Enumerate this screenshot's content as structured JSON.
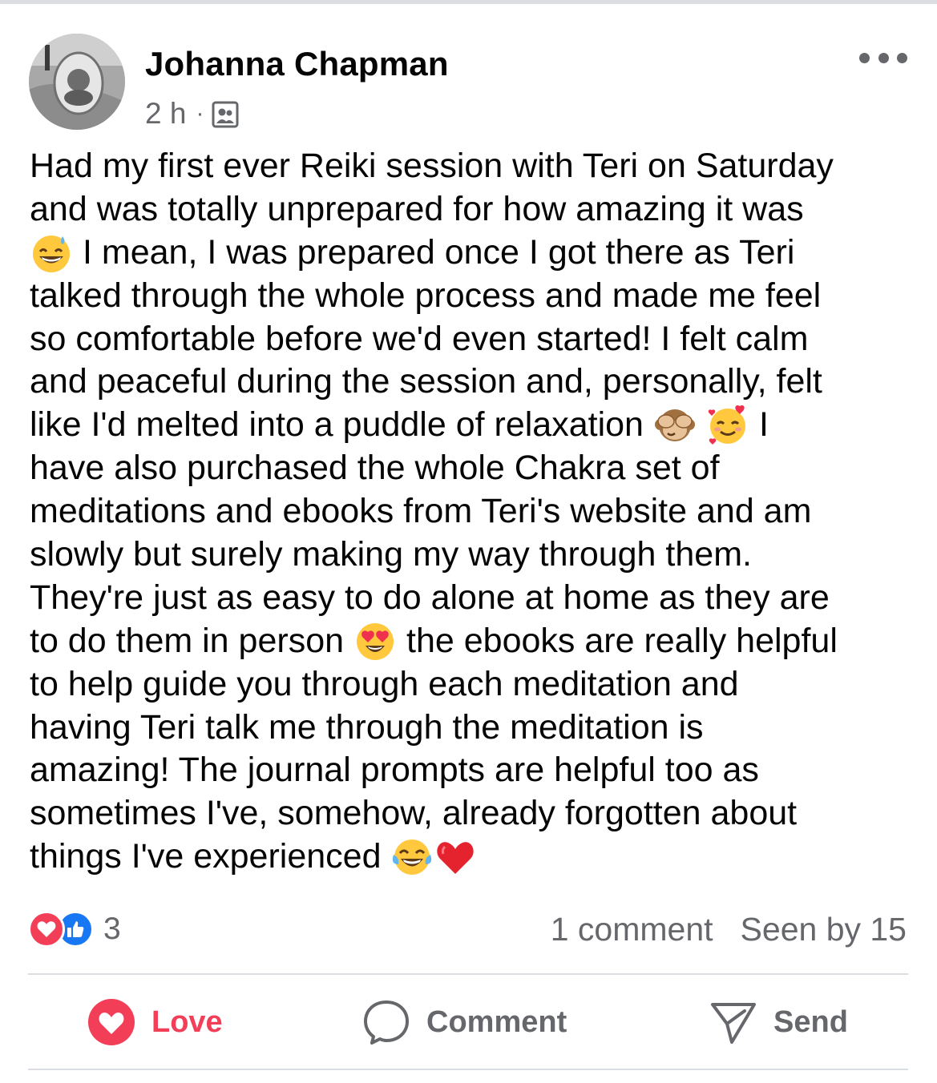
{
  "post": {
    "author": "Johanna Chapman",
    "time": "2 h",
    "separator": "·",
    "audience_icon": "group-audience-icon",
    "more_icon": "more-options-icon",
    "body_lines": [
      "Had my first ever Reiki session with Teri on Saturday",
      "and was totally unprepared for how amazing it was",
      "I mean, I was prepared once I got there as Teri",
      "talked through the whole process and made me feel",
      "so comfortable before we'd even started! I felt calm",
      "and peaceful during the session and, personally, felt",
      "like I'd melted into a puddle of relaxation",
      "I",
      "have also purchased the whole Chakra set of",
      "meditations and ebooks from Teri's website and am",
      "slowly but surely making my way through them.",
      "They're just as easy to do alone at home as they are",
      "to do them in person",
      "the ebooks are really helpful",
      "to help guide you through each meditation and",
      "having Teri talk me through the meditation is",
      "amazing! The journal prompts are helpful too as",
      "sometimes I've, somehow, already forgotten about",
      "things I've experienced"
    ],
    "emojis": [
      "grinning-sweat-emoji",
      "see-no-evil-monkey-emoji",
      "smiling-face-with-hearts-emoji",
      "heart-eyes-emoji",
      "tears-of-joy-emoji",
      "red-heart-emoji"
    ]
  },
  "engagement": {
    "reaction_icons": [
      "love-reaction-icon",
      "like-reaction-icon"
    ],
    "reaction_count": "3",
    "comments": "1 comment",
    "seen_by": "Seen by 15"
  },
  "actions": {
    "love": "Love",
    "comment": "Comment",
    "send": "Send"
  },
  "colors": {
    "text": "#050505",
    "secondary_text": "#65676b",
    "love_red": "#f33e58",
    "like_blue": "#1877f2",
    "divider": "#dadde1"
  }
}
